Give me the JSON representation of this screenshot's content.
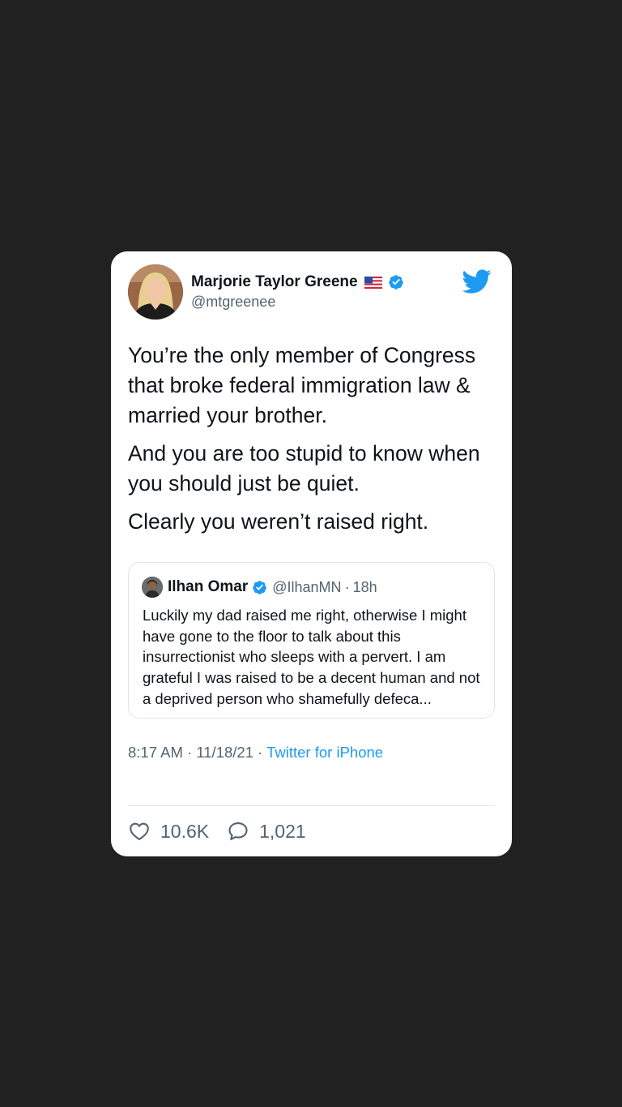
{
  "tweet": {
    "author_name": "Marjorie Taylor Greene",
    "author_flag": "us-flag-emoji",
    "author_handle": "@mtgreenee",
    "paragraphs": [
      "You’re the only member of Congress that broke federal immigration law & married your brother.",
      "And you are too stupid to know when you should just be quiet.",
      "Clearly you weren’t raised right."
    ],
    "time": "8:17 AM",
    "date": "11/18/21",
    "separator": "·",
    "source": "Twitter for iPhone",
    "likes": "10.6K",
    "replies": "1,021"
  },
  "quoted": {
    "author_name": "Ilhan Omar",
    "author_handle": "@IlhanMN",
    "separator": "·",
    "age": "18h",
    "text": "Luckily my dad raised me right, otherwise I might have gone to the floor to talk about this insurrectionist who sleeps with a pervert. I am grateful I was raised to be a decent human and not a deprived person who shamefully defeca..."
  },
  "icons": {
    "logo": "twitter-bird-icon",
    "verified": "verified-badge-icon",
    "like": "heart-icon",
    "reply": "speech-bubble-icon"
  },
  "colors": {
    "background": "#212121",
    "card": "#ffffff",
    "accent": "#1d9bf0",
    "text": "#0f1419",
    "secondary_text": "#536471"
  }
}
